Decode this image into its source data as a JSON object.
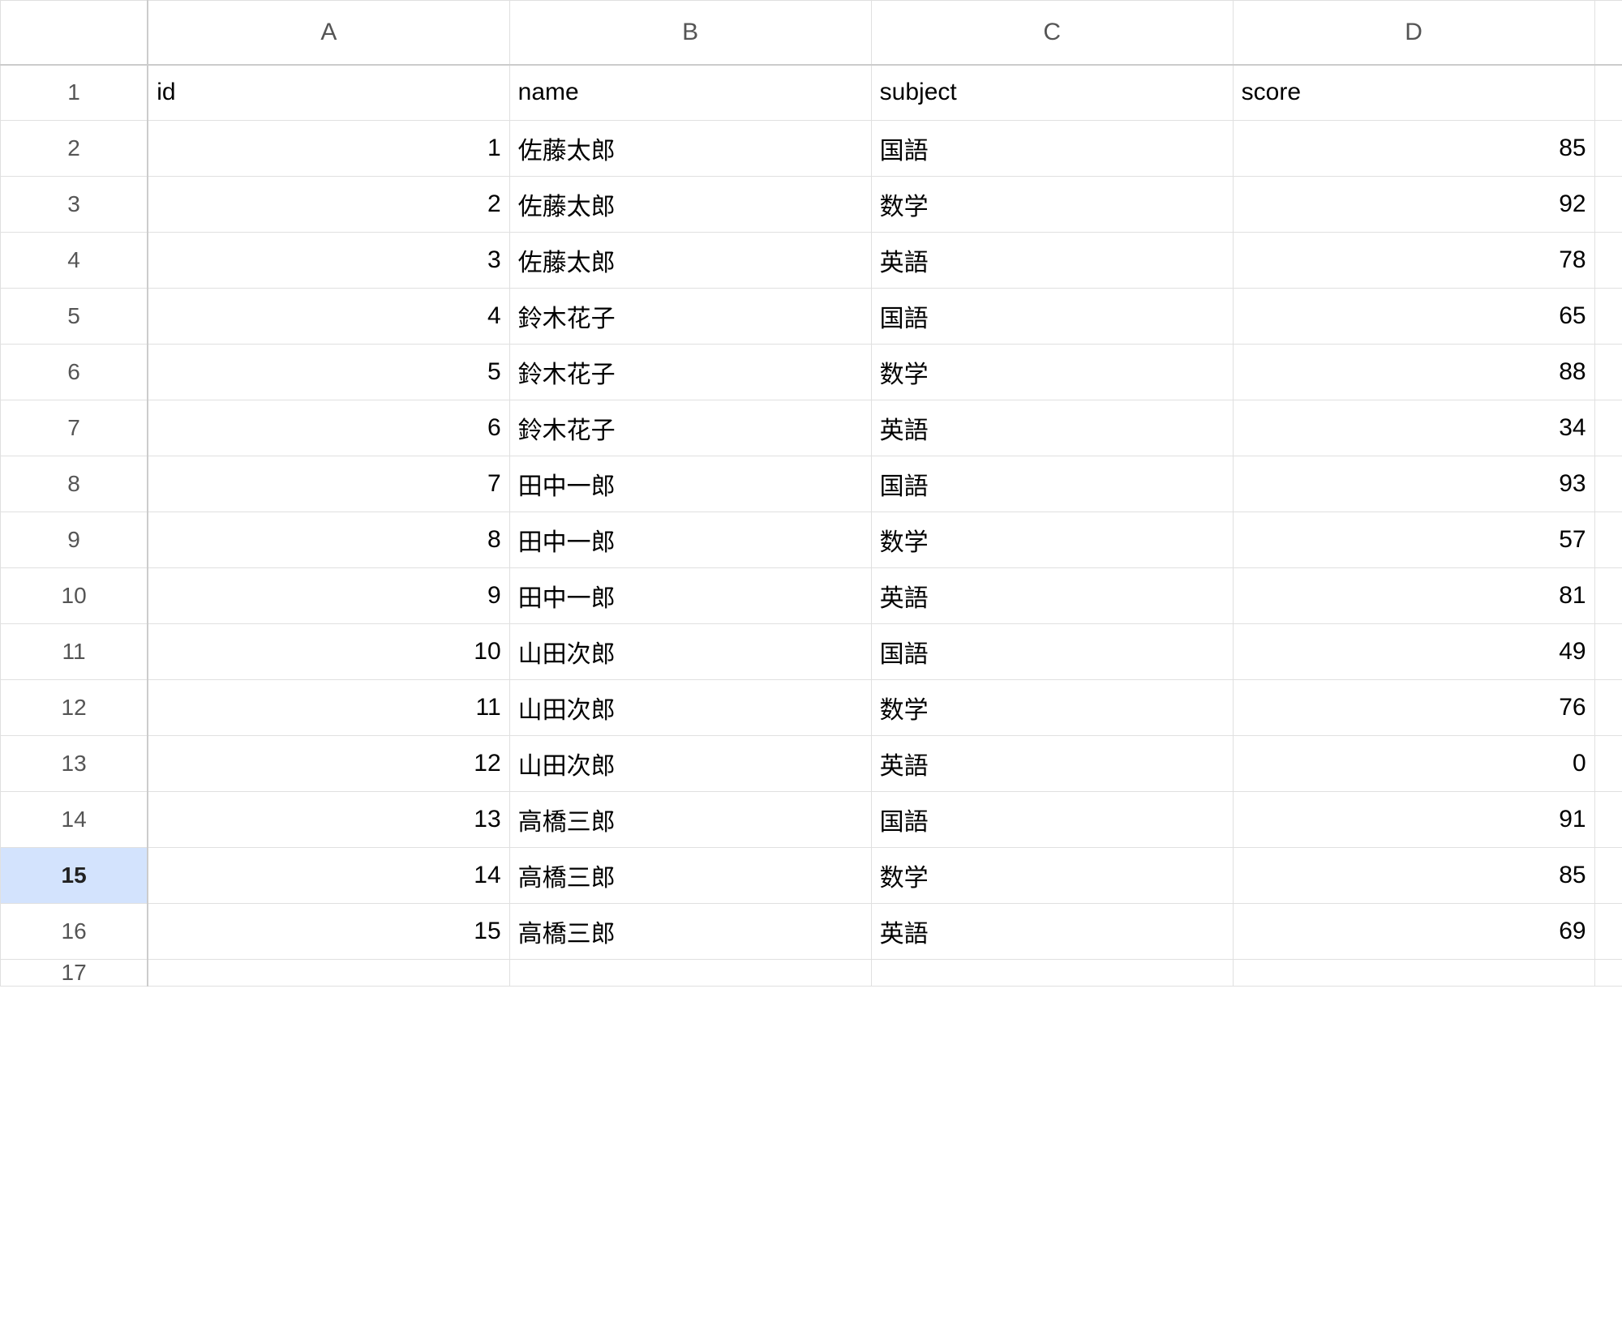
{
  "spreadsheet": {
    "column_letters": [
      "A",
      "B",
      "C",
      "D"
    ],
    "selected_row": 15,
    "visible_row_count": 17,
    "headers": {
      "id": "id",
      "name": "name",
      "subject": "subject",
      "score": "score"
    },
    "rows": [
      {
        "id": 1,
        "name": "佐藤太郎",
        "subject": "国語",
        "score": 85
      },
      {
        "id": 2,
        "name": "佐藤太郎",
        "subject": "数学",
        "score": 92
      },
      {
        "id": 3,
        "name": "佐藤太郎",
        "subject": "英語",
        "score": 78
      },
      {
        "id": 4,
        "name": "鈴木花子",
        "subject": "国語",
        "score": 65
      },
      {
        "id": 5,
        "name": "鈴木花子",
        "subject": "数学",
        "score": 88
      },
      {
        "id": 6,
        "name": "鈴木花子",
        "subject": "英語",
        "score": 34
      },
      {
        "id": 7,
        "name": "田中一郎",
        "subject": "国語",
        "score": 93
      },
      {
        "id": 8,
        "name": "田中一郎",
        "subject": "数学",
        "score": 57
      },
      {
        "id": 9,
        "name": "田中一郎",
        "subject": "英語",
        "score": 81
      },
      {
        "id": 10,
        "name": "山田次郎",
        "subject": "国語",
        "score": 49
      },
      {
        "id": 11,
        "name": "山田次郎",
        "subject": "数学",
        "score": 76
      },
      {
        "id": 12,
        "name": "山田次郎",
        "subject": "英語",
        "score": 0
      },
      {
        "id": 13,
        "name": "高橋三郎",
        "subject": "国語",
        "score": 91
      },
      {
        "id": 14,
        "name": "高橋三郎",
        "subject": "数学",
        "score": 85
      },
      {
        "id": 15,
        "name": "高橋三郎",
        "subject": "英語",
        "score": 69
      }
    ]
  },
  "chart_data": {
    "type": "table",
    "columns": [
      "id",
      "name",
      "subject",
      "score"
    ],
    "data": [
      [
        1,
        "佐藤太郎",
        "国語",
        85
      ],
      [
        2,
        "佐藤太郎",
        "数学",
        92
      ],
      [
        3,
        "佐藤太郎",
        "英語",
        78
      ],
      [
        4,
        "鈴木花子",
        "国語",
        65
      ],
      [
        5,
        "鈴木花子",
        "数学",
        88
      ],
      [
        6,
        "鈴木花子",
        "英語",
        34
      ],
      [
        7,
        "田中一郎",
        "国語",
        93
      ],
      [
        8,
        "田中一郎",
        "数学",
        57
      ],
      [
        9,
        "田中一郎",
        "英語",
        81
      ],
      [
        10,
        "山田次郎",
        "国語",
        49
      ],
      [
        11,
        "山田次郎",
        "数学",
        76
      ],
      [
        12,
        "山田次郎",
        "英語",
        0
      ],
      [
        13,
        "高橋三郎",
        "国語",
        91
      ],
      [
        14,
        "高橋三郎",
        "数学",
        85
      ],
      [
        15,
        "高橋三郎",
        "英語",
        69
      ]
    ]
  }
}
